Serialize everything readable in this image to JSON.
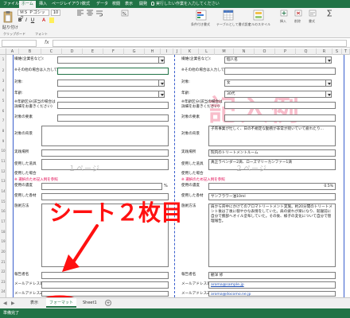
{
  "ribbon": {
    "tabs": [
      "ファイル",
      "ホーム",
      "挿入",
      "ページレイアウト",
      "数式",
      "データ",
      "校閲",
      "表示",
      "開発"
    ],
    "active_tab": "ホーム",
    "tell_me": "実行したい作業を入力してください",
    "font_name": "ＭＳ Ｐゴシック",
    "font_size": "10",
    "paste_label": "貼り付け",
    "clipboard_label": "クリップボード",
    "font_group_label": "フォント",
    "cond_format_label": "条件付き書式",
    "table_format_label": "テーブルとして書式設定",
    "cell_style_label": "セルのスタイル",
    "insert_label": "挿入",
    "delete_label": "削除",
    "format_label": "書式",
    "accent": "#217346"
  },
  "formula_bar": {
    "fx": "fx"
  },
  "columns": [
    "A",
    "B",
    "C",
    "D",
    "E",
    "F",
    "G",
    "H",
    "I",
    "J",
    "K",
    "L",
    "M",
    "N",
    "O",
    "P",
    "Q",
    "R",
    "S",
    "T"
  ],
  "rows": [
    "1",
    "2",
    "3",
    "4",
    "5",
    "6",
    "7",
    "8",
    "9",
    "10",
    "11",
    "12",
    "13",
    "14",
    "15",
    "16",
    "17",
    "18",
    "19",
    "20",
    "21",
    "22",
    "23",
    "24",
    "25",
    "26",
    "27",
    "28",
    "29",
    "30",
    "31",
    "32",
    "33",
    "34"
  ],
  "form": {
    "left": {
      "r1": "繊維(企業名など):",
      "r2": "※その他の場合は入力してください",
      "r3": "対象:",
      "r4": "年齢:",
      "r5": "※年齢区分(該当の場合は詳細をお書きください)",
      "r6": "対象の要素",
      "r7": "対象の背景",
      "r8": "実践場所",
      "r9": "使用した道具",
      "r10": "使用した場合",
      "note1": "※ 選択のため記入例を参照",
      "r11": "使用の濃度",
      "pct": "%",
      "r12": "使用した香材",
      "r13": "施術方法",
      "r14": "報告者名",
      "r15": "メールアドレス1",
      "r16": "メールアドレス2",
      "page_label": "１ページ"
    },
    "right": {
      "r1": "繊維(企業名など):",
      "v1": "個人名",
      "r2": "※その他の場合は入力してください",
      "r3": "対象:",
      "v3": "女",
      "r4": "年齢:",
      "v4": "30代",
      "r5": "※年齢区分(該当の場合は詳細をお書きください)",
      "r6": "対象の要素",
      "r7": "対象の背景",
      "v7": "子育事業が忙しく、日の不規定な勤務が非常が続いていて疲れたり...",
      "r8": "実践場所",
      "v8": "院内のトリートメントルーム",
      "r9": "使用した道具",
      "v9": "真正ラベンダー2滴、ローズマリーカンファー1滴",
      "r10": "使用した場合",
      "note1": "※ 選択のため記入例を参照",
      "r11": "使用の濃度",
      "v11": "0.5%",
      "r12": "使用した香材",
      "v12": "サンフラワー油10ml",
      "r13": "施術方法",
      "v13": "肩から背中にかけてのアロマトリートメント実施。約20分間のトリートメント後は了後に穏やかな表情をしていた。肩の疲れが楽になり、就寝前に自分で腕部へオイル塗布していた。その後、様子の変化について自分で管理報告。",
      "r14": "報告者名",
      "v14": "観洋 修",
      "r15": "メールアドレス1",
      "v15": "aroma@sample.jp",
      "r16": "メールアドレス2",
      "v16": "aroma@docomo.ne.jp",
      "page_label": "２ページ",
      "watermark": "記入例"
    }
  },
  "annotation": "シート２枚目",
  "sheet_tabs": [
    "表示",
    "フォーマット",
    "Sheet1"
  ],
  "active_sheet": "フォーマット",
  "status": {
    "ready": "準備完了"
  }
}
